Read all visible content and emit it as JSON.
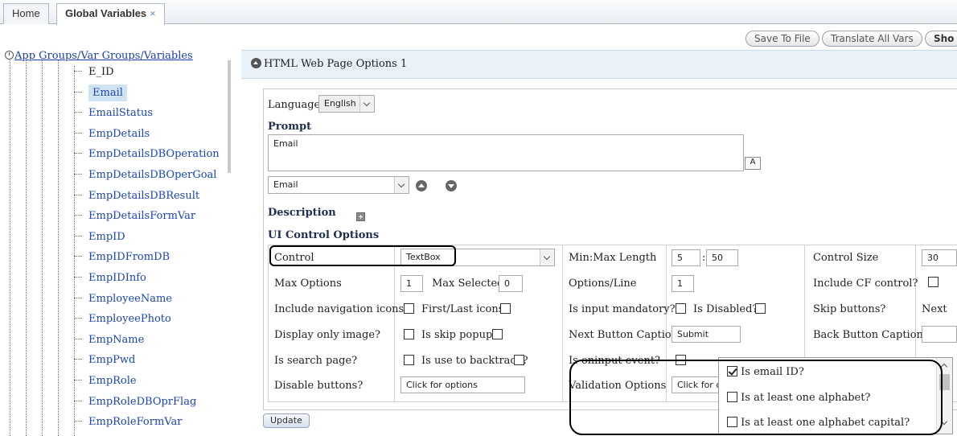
{
  "tabs": {
    "home": "Home",
    "active": "Global Variables",
    "close": "×"
  },
  "tree": {
    "root": "App Groups/Var Groups/Variables",
    "items": [
      "E_ID",
      "Email",
      "EmailStatus",
      "EmpDetails",
      "EmpDetailsDBOperation",
      "EmpDetailsDBOperGoal",
      "EmpDetailsDBResult",
      "EmpDetailsFormVar",
      "EmpID",
      "EmpIDFromDB",
      "EmpIDInfo",
      "EmployeeName",
      "EmployeePhoto",
      "EmpName",
      "EmpPwd",
      "EmpRole",
      "EmpRoleDBOprFlag",
      "EmpRoleFormVar"
    ],
    "selected_index": 1
  },
  "toolbar": {
    "save": "Save To File",
    "translate": "Translate All Vars",
    "show": "Sho"
  },
  "panel": {
    "title": "HTML Web Page Options 1"
  },
  "form": {
    "language_label": "Language:",
    "language_value": "English",
    "prompt_label": "Prompt",
    "prompt_value": "Email",
    "prompt_select": "Email",
    "description_label": "Description",
    "ui_options_label": "UI Control Options",
    "control_label": "Control",
    "control_value": "TextBox",
    "minmax_label": "Min:Max Length",
    "min_value": "5",
    "max_value": "50",
    "control_size_label": "Control Size",
    "control_size_value": "30",
    "max_options_label": "Max Options",
    "max_options_value": "1",
    "max_selected_label": "Max Selected:",
    "max_selected_value": "0",
    "options_line_label": "Options/Line",
    "options_line_value": "1",
    "include_cf_label": "Include CF control?",
    "nav_icons_label": "Include navigation icons?",
    "first_last_label": "First/Last icons?",
    "mandatory_label": "Is input mandatory?",
    "disabled_label": "Is Disabled?",
    "skip_buttons_label": "Skip buttons?",
    "next_label": "Next",
    "display_image_label": "Display only image?",
    "skip_popup_label": "Is skip popup?",
    "next_caption_label": "Next Button Caption",
    "next_caption_value": "Submit",
    "back_caption_label": "Back Button Caption",
    "search_page_label": "Is search page?",
    "backtrack_label": "Is use to backtrack?",
    "oninput_label": "Is oninput event?",
    "disable_buttons_label": "Disable buttons?",
    "disable_buttons_value": "Click for options",
    "validation_label": "Validation Options",
    "validation_value": "Click for o",
    "update": "Update"
  },
  "validation_dropdown": {
    "items": [
      {
        "label": "Is email ID?",
        "checked": true
      },
      {
        "label": "Is at least one alphabet?",
        "checked": false
      },
      {
        "label": "Is at least one alphabet capital?",
        "checked": false
      }
    ]
  }
}
